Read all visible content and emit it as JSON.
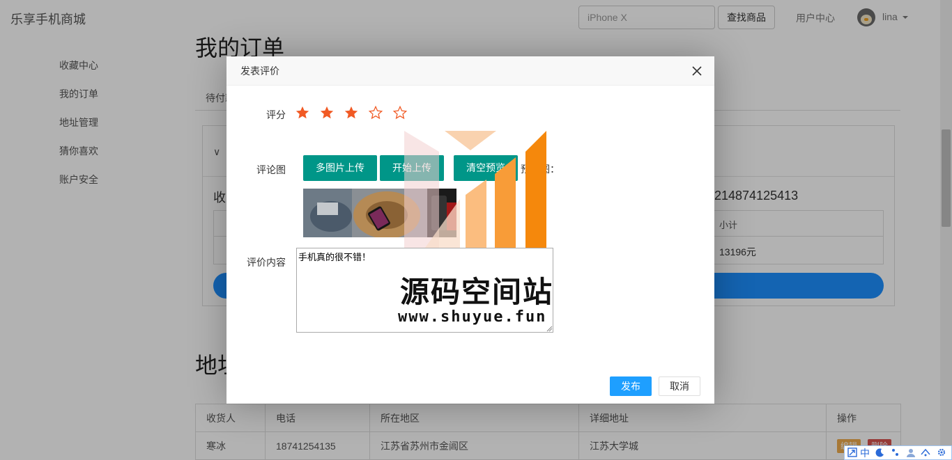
{
  "header": {
    "brand": "乐享手机商城",
    "search_placeholder": "iPhone X",
    "search_button": "查找商品",
    "user_center": "用户中心",
    "username": "lina"
  },
  "sidebar": {
    "items": [
      {
        "label": "收藏中心"
      },
      {
        "label": "我的订单"
      },
      {
        "label": "地址管理"
      },
      {
        "label": "猜你喜欢"
      },
      {
        "label": "账户安全"
      }
    ]
  },
  "orders": {
    "title": "我的订单",
    "tab_pending": "待付款",
    "chevron": "∨",
    "label": "收",
    "order_number": "214874125413",
    "subtotal_header": "小计",
    "subtotal_value": "13196元"
  },
  "address": {
    "title": "地址",
    "columns": [
      "收货人",
      "电话",
      "所在地区",
      "详细地址",
      "操作"
    ],
    "rows": [
      {
        "name": "寒冰",
        "phone": "18741254135",
        "region": "江苏省苏州市金阊区",
        "detail": "江苏大学城",
        "edit": "编辑",
        "delete": "删除"
      }
    ]
  },
  "modal": {
    "title": "发表评价",
    "rating_label": "评分",
    "rating_value": 3,
    "rating_max": 5,
    "images_label": "评论图",
    "btn_multi_upload": "多图片上传",
    "btn_start_upload": "开始上传",
    "btn_clear_preview": "清空预览",
    "preview_label": "预览图：",
    "content_label": "评价内容",
    "content_value": "手机真的很不错！",
    "publish_button": "发布",
    "cancel_button": "取消"
  },
  "watermark": {
    "text_cn": "源码空间站",
    "text_url": "www.shuyue.fun"
  },
  "ime": {
    "mode": "中"
  },
  "colors": {
    "accent_blue": "#1e9fff",
    "teal": "#009688",
    "star": "#f15a24"
  }
}
